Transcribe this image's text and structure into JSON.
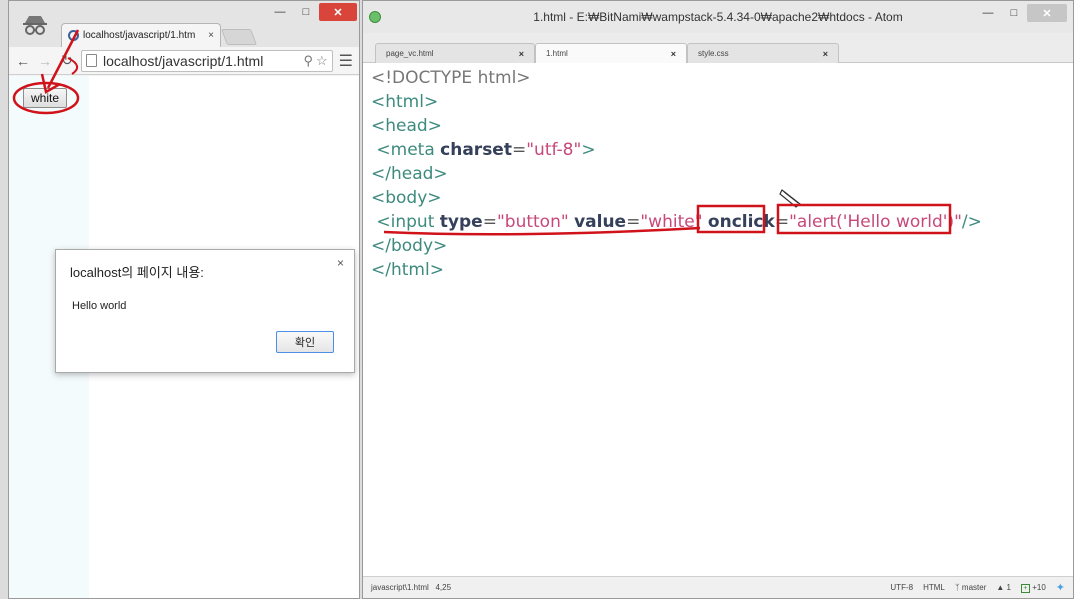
{
  "chrome": {
    "tab_title": "localhost/javascript/1.htm",
    "tab_close": "×",
    "url_host": "localhost",
    "url_path": "/javascript/1.html",
    "button_value": "white",
    "dialog": {
      "title": "localhost의 페이지 내용:",
      "message": "Hello world",
      "ok_label": "확인",
      "close": "×"
    },
    "icons": [
      "incognito-icon",
      "back-icon",
      "forward-icon",
      "reload-icon",
      "page-icon",
      "zoom-icon",
      "star-icon",
      "menu-icon"
    ]
  },
  "atom": {
    "title": "1.html - E:₩BitNami₩wampstack-5.4.34-0₩apache2₩htdocs - Atom",
    "tabs": [
      {
        "label": "page_vc.html",
        "close": "×"
      },
      {
        "label": "1.html",
        "close": "×"
      },
      {
        "label": "style.css",
        "close": "×"
      }
    ],
    "code": {
      "line1": "<!DOCTYPE html>",
      "line2_tag": "<html>",
      "line3_tag": "<head>",
      "line4": {
        "open": " <meta ",
        "attr": "charset",
        "eq": "=",
        "val": "\"utf-8\"",
        "close": ">"
      },
      "line5_tag": "</head>",
      "line6_tag": "<body>",
      "line7": {
        "open": " <input ",
        "attr1": "type",
        "eq1": "=",
        "val1": "\"button\"",
        "attr2": "value",
        "eq2": "=",
        "val2": "\"white\"",
        "attr3": "onclick",
        "eq3": "=",
        "q_open": "\"",
        "val3": "alert('Hello world')",
        "q_close": "\"",
        "close": "/>"
      },
      "line8_tag": "</body>",
      "line9_tag": "</html>"
    },
    "status": {
      "path": "javascript\\1.html",
      "cursor": "4,25",
      "encoding": "UTF-8",
      "grammar": "HTML",
      "branch": "master",
      "ahead": "1",
      "changes": "+10"
    }
  },
  "colors": {
    "tag": "#3d8a7e",
    "attribute": "#35405a",
    "string": "#c7487a",
    "annotation": "#d0121b",
    "chrome_close": "#d9453a"
  }
}
